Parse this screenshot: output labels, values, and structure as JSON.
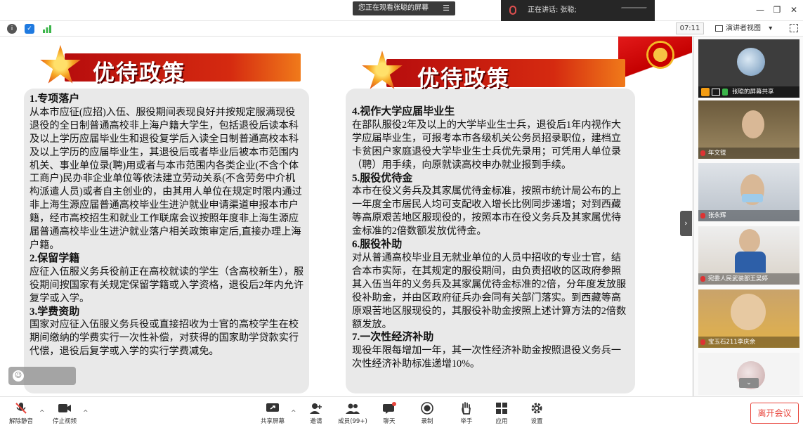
{
  "titlebar": {
    "share_notice": "您正在观看张聪的屏幕",
    "menu_glyph": "☰",
    "speaker": "正在讲话: 张聪;"
  },
  "toolbar": {
    "time": "07:11",
    "view_label": "演讲者视图",
    "view_caret": "▾"
  },
  "slide": {
    "banner_title": "优待政策",
    "left_paragraphs": [
      {
        "heading": true,
        "text": "1.专项落户"
      },
      {
        "heading": false,
        "text": "从本市应征(应招)入伍、服役期间表现良好并按规定服满现役退役的全日制普通高校非上海户籍大学生，包括退役后读本科及以上学历应届毕业生和退役复学后入读全日制普通高校本科及以上学历的应届毕业生，其退役后或者毕业后被本市范围内机关、事业单位录(聘)用或者与本市范围内各类企业(不含个体工商户)民办非企业单位等依法建立劳动关系(不含劳务中介机构派遣人员)或者自主创业的，由其用人单位在规定时限内通过非上海生源应届普通高校毕业生进沪就业申请渠道申报本市户籍，经市高校招生和就业工作联席会议按照年度非上海生源应届普通高校毕业生进沪就业落户相关政策审定后,直接办理上海户籍。"
      },
      {
        "heading": true,
        "text": "2.保留学籍"
      },
      {
        "heading": false,
        "text": "应征入伍服义务兵役前正在高校就读的学生（含高校新生），服役期间按国家有关规定保留学籍或入学资格，退役后2年内允许复学或入学。"
      },
      {
        "heading": true,
        "text": "3.学费资助"
      },
      {
        "heading": false,
        "text": "国家对应征入伍服义务兵役或直接招收为士官的高校学生在校期间缴纳的学费实行一次性补偿，对获得的国家助学贷款实行代偿，退役后复学或入学的实行学费减免。"
      }
    ],
    "right_paragraphs": [
      {
        "heading": true,
        "text": "4.视作大学应届毕业生"
      },
      {
        "heading": false,
        "text": "在部队服役2年及以上的大学毕业生士兵，退役后1年内视作大学应届毕业生，可报考本市各级机关公务员招录职位，建档立卡贫困户家庭退役大学毕业生士兵优先录用；可凭用人单位录（聘）用手续，向原就读高校申办就业报到手续。"
      },
      {
        "heading": true,
        "text": "5.服役优待金"
      },
      {
        "heading": false,
        "text": "本市在役义务兵及其家属优待金标准，按照市统计局公布的上一年度全市居民人均可支配收入增长比例同步递增；对到西藏等高原艰苦地区服现役的，按照本市在役义务兵及其家属优待金标准的2倍数额发放优待金。"
      },
      {
        "heading": true,
        "text": "6.服役补助"
      },
      {
        "heading": false,
        "text": "对从普通高校毕业且无就业单位的人员中招收的专业士官，结合本市实际，在其规定的服役期间，由负责招收的区政府参照其入伍当年的义务兵及其家属优待金标准的2倍，分年度发放服役补助金，并由区政府征兵办会同有关部门落实。到西藏等高原艰苦地区服现役的，其服役补助金按照上述计算方法的2倍数额发放。"
      },
      {
        "heading": true,
        "text": "7.一次性经济补助"
      },
      {
        "heading": false,
        "text": "现役年限每增加一年，其一次性经济补助金按照退役义务兵一次性经济补助标准递增10%。"
      }
    ]
  },
  "participants": [
    {
      "name": "张聪的屏幕共享"
    },
    {
      "name": "年文锟"
    },
    {
      "name": "张永辉"
    },
    {
      "name": "宛委人民武装部王吴婷"
    },
    {
      "name": "宝玉石211李庆余"
    }
  ],
  "bottombar": {
    "buttons": [
      {
        "label": "解除静音"
      },
      {
        "label": "停止视频"
      },
      {
        "label": "共享屏幕"
      },
      {
        "label": "邀请"
      },
      {
        "label": "成员(99+)"
      },
      {
        "label": "聊天"
      },
      {
        "label": "录制"
      },
      {
        "label": "举手"
      },
      {
        "label": "应用"
      },
      {
        "label": "设置"
      }
    ],
    "caret": "^",
    "leave_label": "离开会议"
  },
  "colors": {
    "banner_red": "#c40000",
    "banner_orange": "#f07a1a",
    "leave_red": "#e8453c"
  }
}
